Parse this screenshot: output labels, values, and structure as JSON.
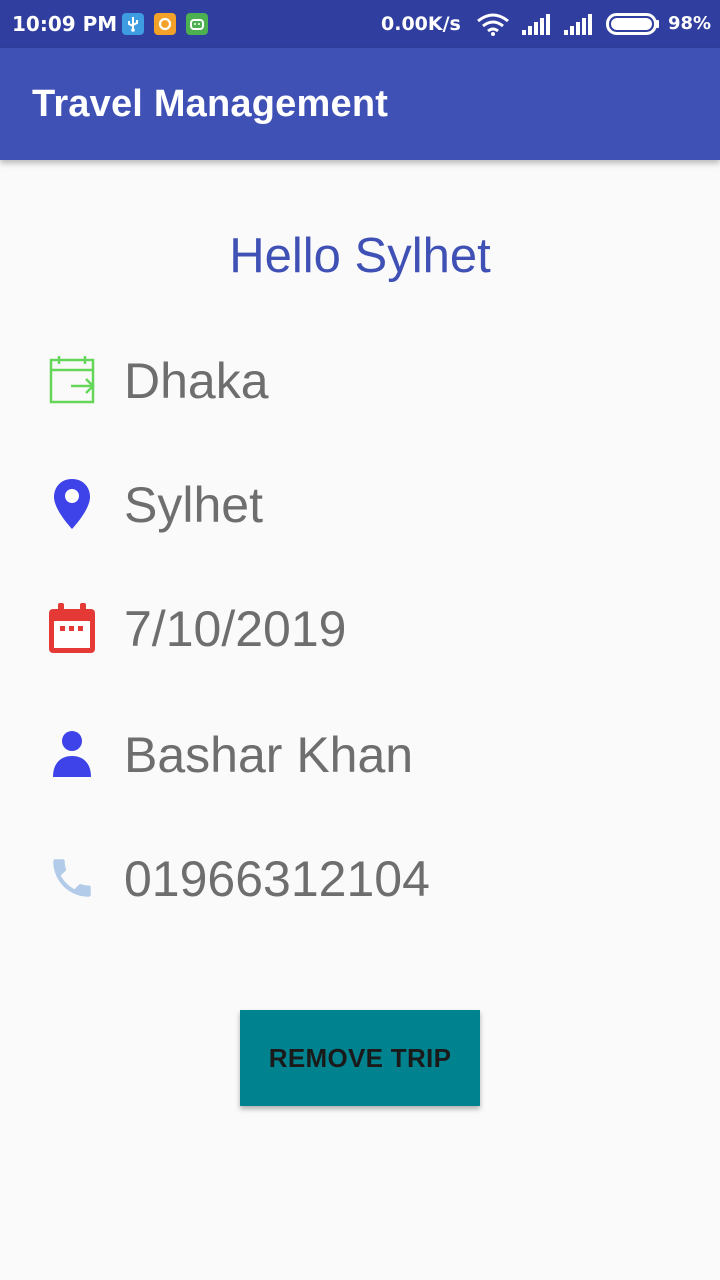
{
  "status_bar": {
    "time": "10:09 PM",
    "network_speed": "0.00K/s",
    "battery": "98%",
    "icons": [
      "usb-icon",
      "chat-notification-icon",
      "android-notification-icon",
      "wifi-icon",
      "signal-icon",
      "signal-icon",
      "battery-icon"
    ]
  },
  "app_bar": {
    "title": "Travel Management",
    "color": "#3f51b5"
  },
  "trip": {
    "greeting": "Hello Sylhet",
    "origin": "Dhaka",
    "destination": "Sylhet",
    "date": "7/10/2019",
    "name": "Bashar Khan",
    "phone": "01966312104"
  },
  "icons": {
    "origin": "calendar-departure-icon",
    "destination": "location-pin-icon",
    "date": "calendar-icon",
    "name": "person-icon",
    "phone": "phone-icon"
  },
  "actions": {
    "remove_label": "REMOVE TRIP"
  },
  "colors": {
    "accent": "#3f51b5",
    "button": "#00838f",
    "status_bar": "#303f9f"
  }
}
